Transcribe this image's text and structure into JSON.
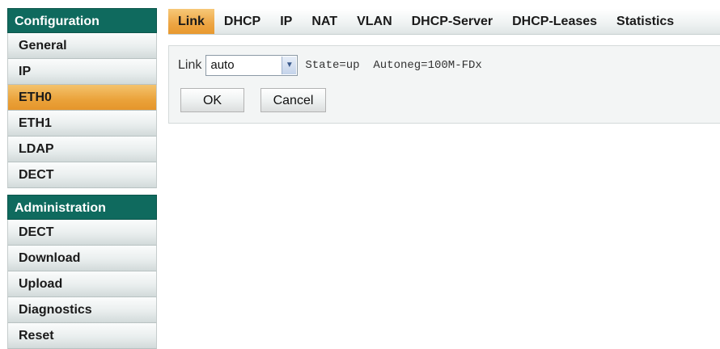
{
  "sidebar": {
    "sections": [
      {
        "title": "Configuration",
        "items": [
          "General",
          "IP",
          "ETH0",
          "ETH1",
          "LDAP",
          "DECT"
        ],
        "active_item": "ETH0"
      },
      {
        "title": "Administration",
        "items": [
          "DECT",
          "Download",
          "Upload",
          "Diagnostics",
          "Reset"
        ]
      }
    ]
  },
  "tabs": {
    "items": [
      "Link",
      "DHCP",
      "IP",
      "NAT",
      "VLAN",
      "DHCP-Server",
      "DHCP-Leases",
      "Statistics"
    ],
    "active": "Link"
  },
  "form": {
    "link_label": "Link",
    "link_value": "auto",
    "status": "State=up  Autoneg=100M-FDx",
    "ok_label": "OK",
    "cancel_label": "Cancel"
  },
  "colors": {
    "header_bg": "#0f6a5e",
    "active_bg": "#eda543"
  }
}
